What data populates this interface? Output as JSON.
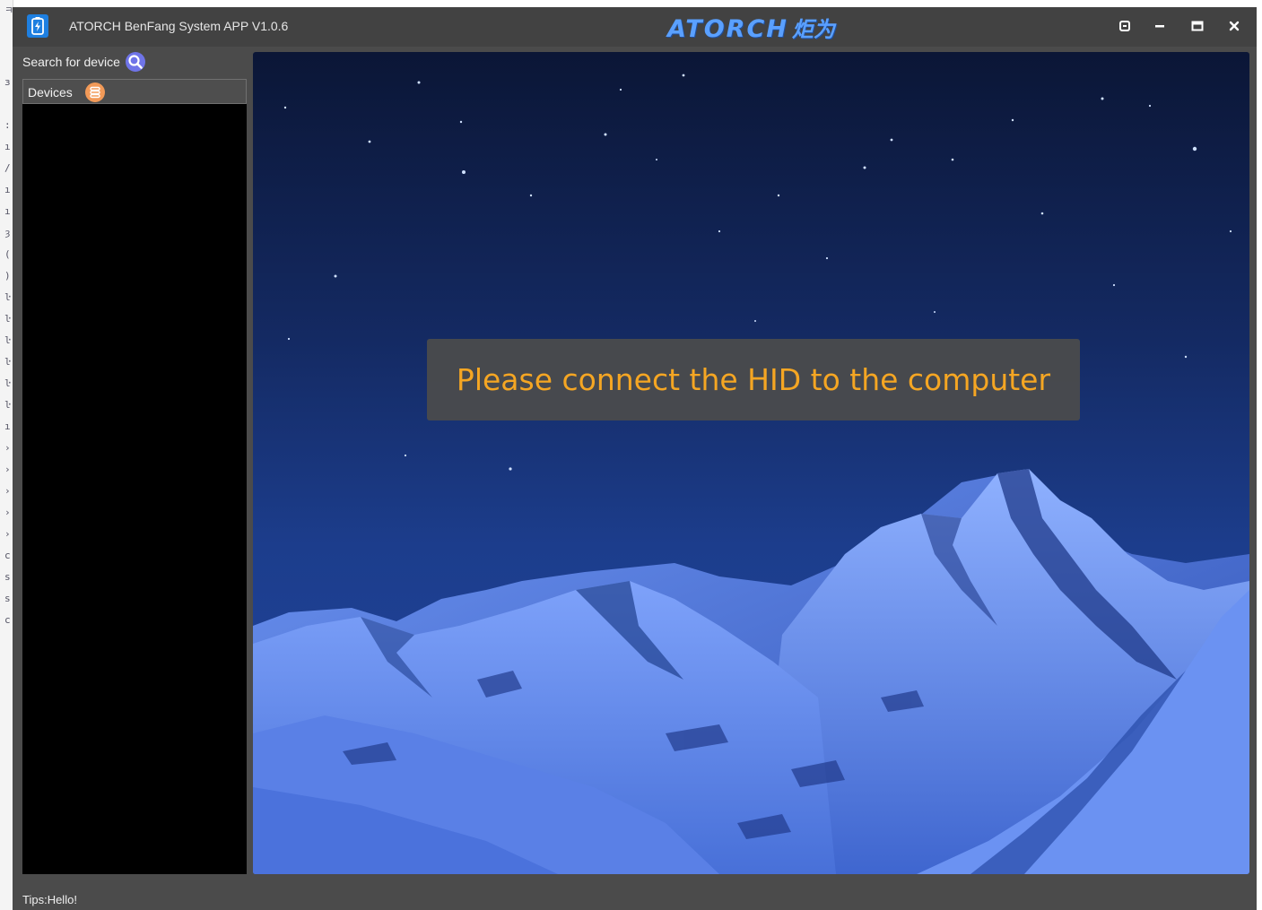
{
  "window": {
    "title": "ATORCH BenFang System APP V1.0.6",
    "brand_en": "ATORCH",
    "brand_cn": "炬为",
    "controls": [
      "restore-down",
      "minimize",
      "maximize",
      "close"
    ]
  },
  "sidebar": {
    "search_label": "Search for device",
    "devices_label": "Devices",
    "devices": []
  },
  "main": {
    "message": "Please connect the HID to the computer"
  },
  "status": {
    "tips": "Tips:Hello!"
  },
  "icons": {
    "app": "battery-bolt-icon",
    "search": "search-icon",
    "devices": "device-list-icon"
  },
  "colors": {
    "message": "#f5a623",
    "brand": "#5aa0ff",
    "search_icon_bg": "#6f74e8",
    "devices_icon_bg": "#f29a58"
  }
}
